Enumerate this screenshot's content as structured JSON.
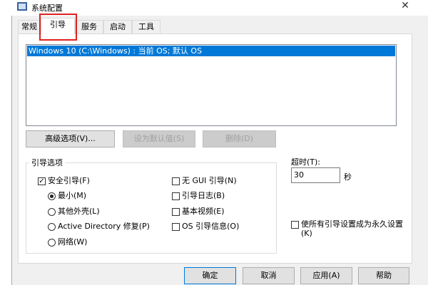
{
  "window": {
    "title": "系统配置",
    "close": "✕"
  },
  "tabs": [
    {
      "label": "常规"
    },
    {
      "label": "引导"
    },
    {
      "label": "服务"
    },
    {
      "label": "启动"
    },
    {
      "label": "工具"
    }
  ],
  "boot_list": [
    "Windows 10 (C:\\Windows) : 当前 OS; 默认 OS"
  ],
  "buttons": {
    "advanced": "高级选项(V)...",
    "set_default": "设为默认值(S)",
    "delete": "删除(D)"
  },
  "boot_options": {
    "title": "引导选项",
    "safe_boot": {
      "label": "安全引导(F)",
      "checked": true
    },
    "radios": [
      {
        "label": "最小(M)",
        "checked": true
      },
      {
        "label": "其他外壳(L)",
        "checked": false
      },
      {
        "label": "Active Directory 修复(P)",
        "checked": false
      },
      {
        "label": "网络(W)",
        "checked": false
      }
    ],
    "checks": [
      {
        "label": "无 GUI 引导(N)",
        "checked": false
      },
      {
        "label": "引导日志(B)",
        "checked": false
      },
      {
        "label": "基本视频(E)",
        "checked": false
      },
      {
        "label": "OS 引导信息(O)",
        "checked": false
      }
    ]
  },
  "timeout": {
    "label": "超时(T):",
    "value": "30",
    "unit": "秒"
  },
  "permanent": {
    "label": "使所有引导设置成为永久设置",
    "label2": "(K)",
    "checked": false
  },
  "footer": {
    "ok": "确定",
    "cancel": "取消",
    "apply": "应用(A)",
    "help": "帮助"
  }
}
